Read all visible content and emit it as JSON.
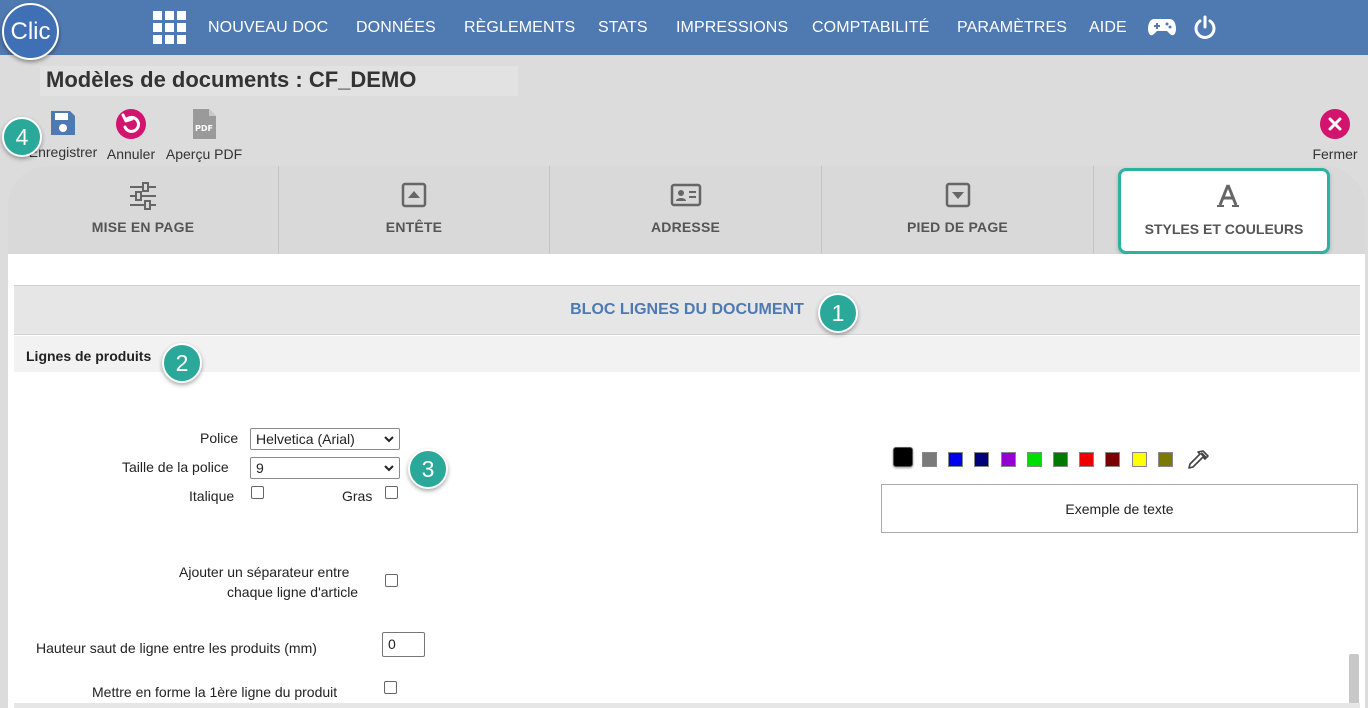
{
  "app": {
    "logo_text": "Clic"
  },
  "nav": {
    "items": [
      "NOUVEAU DOC",
      "DONNÉES",
      "RÈGLEMENTS",
      "STATS",
      "IMPRESSIONS",
      "COMPTABILITÉ",
      "PARAMÈTRES",
      "AIDE"
    ],
    "icons": [
      "grid-icon",
      "gamepad-icon",
      "power-icon"
    ]
  },
  "page": {
    "title": "Modèles de documents  : CF_DEMO"
  },
  "toolbar": {
    "save_label": "Enregistrer",
    "cancel_label": "Annuler",
    "pdf_label": "Aperçu PDF",
    "pdf_icon_text": "PDF",
    "close_label": "Fermer"
  },
  "tabs": [
    {
      "label": "MISE EN PAGE",
      "icon": "sliders-icon",
      "active": false
    },
    {
      "label": "ENTÊTE",
      "icon": "header-icon",
      "active": false
    },
    {
      "label": "ADRESSE",
      "icon": "address-card-icon",
      "active": false
    },
    {
      "label": "PIED DE PAGE",
      "icon": "footer-icon",
      "active": false
    },
    {
      "label": "STYLES ET COULEURS",
      "icon": "font-icon",
      "active": true
    }
  ],
  "section": {
    "title": "BLOC LIGNES DU DOCUMENT",
    "subtitle": "Lignes de produits"
  },
  "form": {
    "font_label": "Police",
    "font_value": "Helvetica (Arial)",
    "size_label": "Taille de la police",
    "size_value": "9",
    "italic_label": "Italique",
    "bold_label": "Gras",
    "separator_label_1": "Ajouter un séparateur entre",
    "separator_label_2": "chaque ligne d'article",
    "spacing_label": "Hauteur saut de ligne entre les produits (mm)",
    "spacing_value": "0",
    "first_line_label": "Mettre en forme la 1ère ligne du produit"
  },
  "colors": {
    "swatches": [
      "#000000",
      "#7a7a7a",
      "#0000ee",
      "#00007a",
      "#9400d3",
      "#00dd00",
      "#007a00",
      "#ee0000",
      "#7a0000",
      "#ffff00",
      "#7a7a00"
    ],
    "selected": "#000000",
    "picker_icon": "eyedropper-icon"
  },
  "preview": {
    "text": "Exemple de texte"
  },
  "annotations": [
    "1",
    "2",
    "3",
    "4"
  ],
  "theme": {
    "nav_bg": "#4f79b1",
    "accent_teal": "#2aa99a",
    "magenta": "#d2146e",
    "title_blue": "#4f79b1"
  }
}
